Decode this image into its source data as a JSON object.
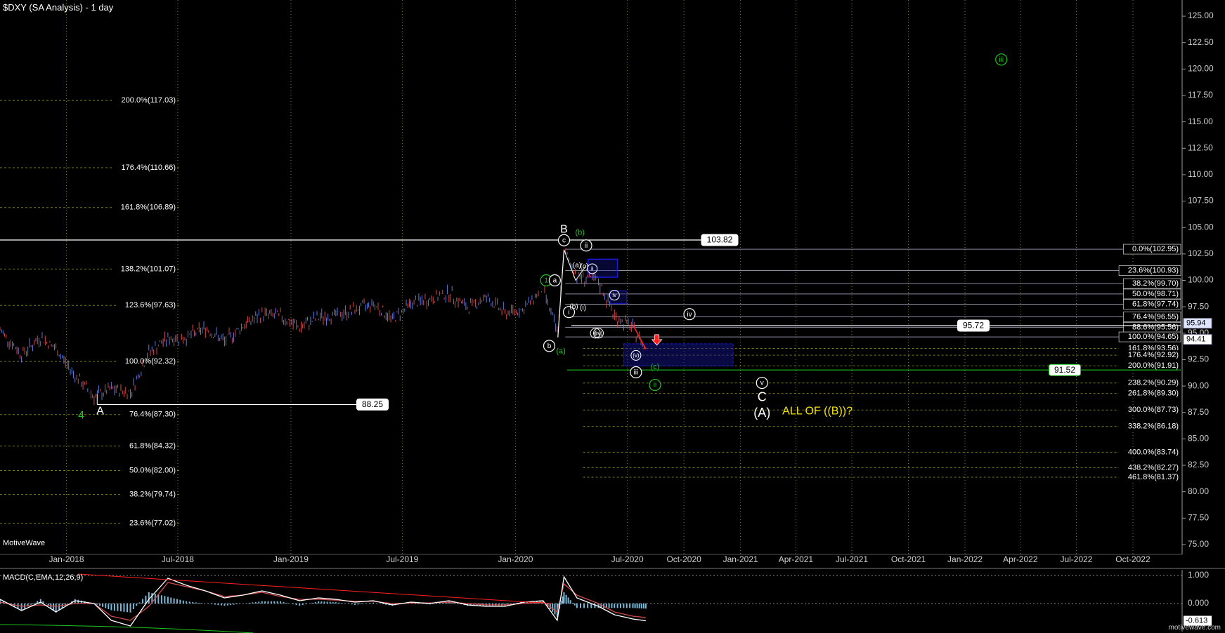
{
  "header": {
    "title": "$DXY (SA Analysis) - 1 day",
    "brand": "MotiveWave",
    "watermark": "motivewave.com"
  },
  "chart_data": {
    "type": "line",
    "title": "$DXY (SA Analysis) - 1 day",
    "ylim": [
      74.2,
      126.0
    ],
    "y_ticks": [
      "125.00",
      "122.50",
      "120.00",
      "117.50",
      "115.00",
      "112.50",
      "110.00",
      "107.50",
      "105.00",
      "102.50",
      "100.00",
      "97.50",
      "95.00",
      "92.50",
      "90.00",
      "87.50",
      "85.00",
      "82.50",
      "80.00",
      "77.50",
      "75.00"
    ],
    "x_ticks": [
      "Jan-2018",
      "Jul-2018",
      "Jan-2019",
      "Jul-2019",
      "Jan-2020",
      "Jul-2020",
      "Oct-2020",
      "Jan-2021",
      "Apr-2021",
      "Jul-2021",
      "Oct-2021",
      "Jan-2022",
      "Apr-2022",
      "Jul-2022",
      "Oct-2022"
    ],
    "x_range": [
      "2017-09-15",
      "2022-12-20"
    ],
    "price_series": {
      "name": "DXY",
      "x": [
        "2017-09-15",
        "2017-10-20",
        "2017-11-20",
        "2017-12-15",
        "2018-01-15",
        "2018-02-15",
        "2018-03-15",
        "2018-04-15",
        "2018-05-15",
        "2018-06-15",
        "2018-07-15",
        "2018-08-15",
        "2018-09-15",
        "2018-10-15",
        "2018-11-15",
        "2018-12-15",
        "2019-01-15",
        "2019-02-15",
        "2019-03-15",
        "2019-04-15",
        "2019-05-15",
        "2019-06-15",
        "2019-07-15",
        "2019-08-15",
        "2019-09-15",
        "2019-10-15",
        "2019-11-15",
        "2019-12-15",
        "2020-01-15",
        "2020-02-15",
        "2020-03-09",
        "2020-03-20",
        "2020-04-10",
        "2020-05-15",
        "2020-06-10",
        "2020-07-10",
        "2020-07-31"
      ],
      "y": [
        95.3,
        93.0,
        94.6,
        93.5,
        91.0,
        89.0,
        89.7,
        89.4,
        93.2,
        94.5,
        94.6,
        95.5,
        94.2,
        95.7,
        96.8,
        96.6,
        95.5,
        96.5,
        96.7,
        97.2,
        97.8,
        96.3,
        97.8,
        98.2,
        98.8,
        97.4,
        98.4,
        96.9,
        97.3,
        99.3,
        95.0,
        102.9,
        100.4,
        99.9,
        96.6,
        95.5,
        93.5
      ]
    },
    "fib_left": [
      {
        "label": "200.0%(117.03)",
        "value": 117.03
      },
      {
        "label": "176.4%(110.66)",
        "value": 110.66
      },
      {
        "label": "161.8%(106.89)",
        "value": 106.89
      },
      {
        "label": "138.2%(101.07)",
        "value": 101.07
      },
      {
        "label": "123.6%(97.63)",
        "value": 97.63
      },
      {
        "label": "100.0%(92.32)",
        "value": 92.32
      },
      {
        "label": "76.4%(87.30)",
        "value": 87.3
      },
      {
        "label": "61.8%(84.32)",
        "value": 84.32
      },
      {
        "label": "50.0%(82.00)",
        "value": 82.0
      },
      {
        "label": "38.2%(79.74)",
        "value": 79.74
      },
      {
        "label": "23.6%(77.02)",
        "value": 77.02
      }
    ],
    "fib_right_retrace": [
      {
        "label": "0.0%(102.95)",
        "value": 102.95
      },
      {
        "label": "23.6%(100.93)",
        "value": 100.93
      },
      {
        "label": "38.2%(99.70)",
        "value": 99.7
      },
      {
        "label": "50.0%(98.71)",
        "value": 98.71
      },
      {
        "label": "61.8%(97.74)",
        "value": 97.74
      },
      {
        "label": "76.4%(96.55)",
        "value": 96.55
      },
      {
        "label": "88.6%(95.56)",
        "value": 95.56
      },
      {
        "label": "100.0%(94.65)",
        "value": 94.65
      }
    ],
    "fib_right_ext": [
      {
        "label": "161.8%(93.56)",
        "value": 93.56
      },
      {
        "label": "176.4%(92.92)",
        "value": 92.92
      },
      {
        "label": "200.0%(91.91)",
        "value": 91.91
      },
      {
        "label": "238.2%(90.29)",
        "value": 90.29
      },
      {
        "label": "261.8%(89.30)",
        "value": 89.3
      },
      {
        "label": "300.0%(87.73)",
        "value": 87.73
      },
      {
        "label": "338.2%(86.18)",
        "value": 86.18
      },
      {
        "label": "400.0%(83.74)",
        "value": 83.74
      },
      {
        "label": "438.2%(82.27)",
        "value": 82.27
      },
      {
        "label": "461.8%(81.37)",
        "value": 81.37
      }
    ],
    "price_levels": [
      {
        "label": "103.82",
        "value": 103.82
      },
      {
        "label": "95.72",
        "value": 95.72
      },
      {
        "label": "91.52",
        "value": 91.52
      },
      {
        "label": "88.25",
        "value": 88.25
      }
    ],
    "right_axis_price_labels": [
      "95.94",
      "94.41"
    ],
    "wave_labels": [
      "A",
      "4",
      "B",
      "(b)",
      "(a)",
      "1",
      "a",
      "b",
      "c",
      "ii",
      "i",
      "iii",
      "iv",
      "v",
      "(v)",
      "iv",
      "(iv)",
      "ii",
      "iii",
      "C",
      "(A)",
      "v",
      "(c)",
      "ii",
      "iii",
      "(a)",
      "(c)",
      "(b)",
      "(i)",
      "(iii)",
      "(ii)"
    ],
    "annotation": "ALL OF ((B))?",
    "macd": {
      "title": "MACD(C,EMA,12,26,9)",
      "y_ticks": [
        "1.000",
        "0.000"
      ],
      "last_value_label": "-0.613",
      "ylim": [
        -1.0,
        1.2
      ],
      "macd_line": [
        0.15,
        -0.25,
        0.05,
        -0.3,
        0.1,
        0.0,
        -0.6,
        -0.8,
        0.15,
        0.9,
        0.65,
        0.45,
        0.2,
        0.3,
        0.45,
        0.3,
        0.1,
        0.2,
        0.15,
        0.05,
        0.1,
        -0.05,
        0.05,
        0.0,
        0.1,
        -0.05,
        -0.1,
        -0.1,
        0.05,
        0.1,
        -0.6,
        0.95,
        0.2,
        -0.1,
        -0.4,
        -0.55,
        -0.613
      ],
      "signal_line": [
        0.05,
        -0.1,
        -0.05,
        -0.1,
        0.0,
        0.0,
        -0.45,
        -0.6,
        -0.1,
        0.75,
        0.6,
        0.45,
        0.25,
        0.3,
        0.4,
        0.25,
        0.15,
        0.15,
        0.12,
        0.08,
        0.08,
        0.0,
        0.02,
        0.02,
        0.05,
        0.0,
        -0.05,
        -0.05,
        0.0,
        0.05,
        -0.3,
        0.7,
        0.3,
        0.0,
        -0.3,
        -0.45,
        -0.5
      ]
    }
  },
  "colors": {
    "white": "#ffffff",
    "green": "#1ec81e",
    "yellow": "#f0e000",
    "red": "#ff2020",
    "blue_box": "#1a1ad8",
    "bar_up": "#5a7ad8",
    "bar_down": "#d04a4a",
    "grid": "#7a7a20",
    "fib_line": "#8a8aa0",
    "hist": "#7ab8d8"
  }
}
